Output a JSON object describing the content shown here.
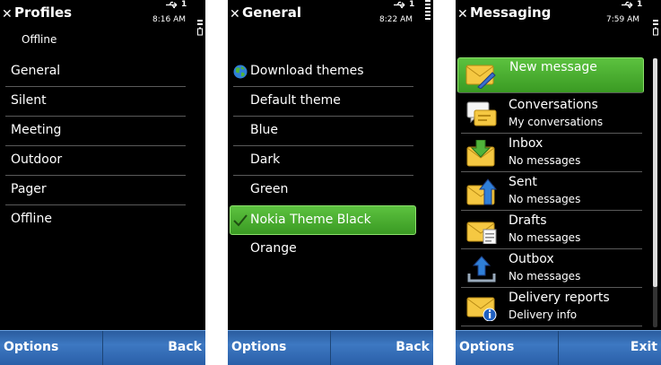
{
  "screens": [
    {
      "title": "Profiles",
      "time": "8:16 AM",
      "subtitle": "Offline",
      "items": [
        "General",
        "Silent",
        "Meeting",
        "Outdoor",
        "Pager",
        "Offline"
      ],
      "softkeys": {
        "left": "Options",
        "right": "Back"
      }
    },
    {
      "title": "General",
      "time": "8:22 AM",
      "items": [
        "Download themes",
        "Default theme",
        "Blue",
        "Dark",
        "Green",
        "Nokia Theme Black",
        "Orange"
      ],
      "selected_item": "Nokia Theme Black",
      "softkeys": {
        "left": "Options",
        "right": "Back"
      }
    },
    {
      "title": "Messaging",
      "time": "7:59 AM",
      "items": [
        {
          "title": "New message",
          "subtitle": "",
          "icon": "new-message-icon"
        },
        {
          "title": "Conversations",
          "subtitle": "My conversations",
          "icon": "conversations-icon"
        },
        {
          "title": "Inbox",
          "subtitle": "No messages",
          "icon": "inbox-icon"
        },
        {
          "title": "Sent",
          "subtitle": "No messages",
          "icon": "sent-icon"
        },
        {
          "title": "Drafts",
          "subtitle": "No messages",
          "icon": "drafts-icon"
        },
        {
          "title": "Outbox",
          "subtitle": "No messages",
          "icon": "outbox-icon"
        },
        {
          "title": "Delivery reports",
          "subtitle": "Delivery info",
          "icon": "delivery-reports-icon"
        }
      ],
      "softkeys": {
        "left": "Options",
        "right": "Exit"
      }
    }
  ],
  "status": {
    "usb_icon": "usb-icon",
    "indicator": "1",
    "battery_icon": "battery-icon"
  },
  "colors": {
    "highlight": "#4aae2e",
    "softkey_bar": "#3468b0",
    "background": "#000000"
  }
}
